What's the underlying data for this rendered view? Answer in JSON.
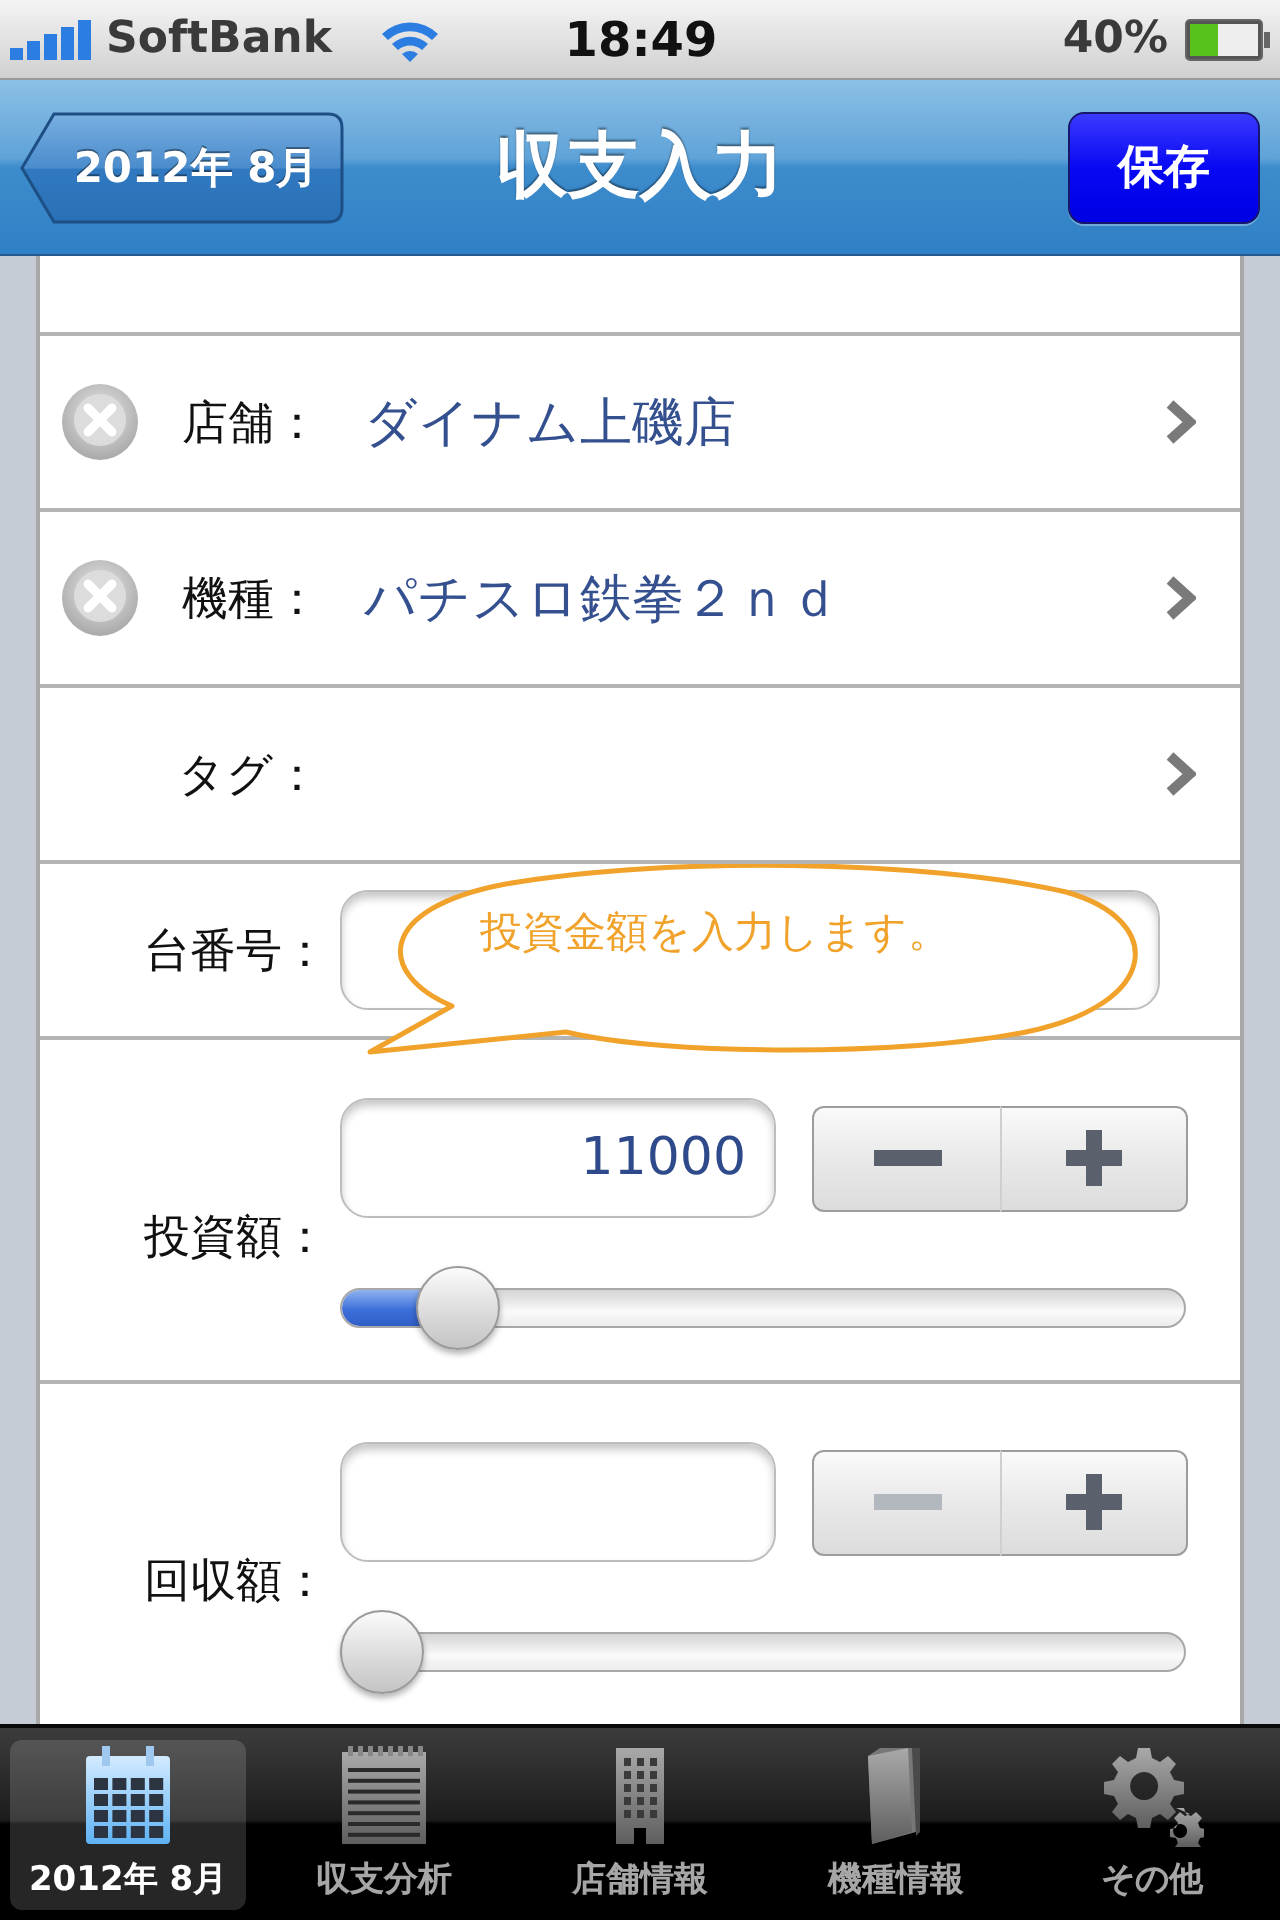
{
  "status_bar": {
    "carrier": "SoftBank",
    "time": "18:49",
    "battery": "40%"
  },
  "nav_bar": {
    "back_button": "2012年 8月",
    "title": "収支入力",
    "save_button": "保存"
  },
  "form": {
    "rows": [
      {
        "kind": "picker",
        "label": "店舗：",
        "value": "ダイナム上磯店",
        "clear_button": true
      },
      {
        "kind": "picker",
        "label": "機種：",
        "value": "パチスロ鉄拳２ｎｄ",
        "clear_button": true
      },
      {
        "kind": "picker",
        "label": "タグ：",
        "clear_button": false
      },
      {
        "kind": "text",
        "label": "台番号："
      },
      {
        "kind": "amount",
        "label": "投資額：",
        "value": "11000",
        "minus_enabled": true,
        "level": 0.1
      },
      {
        "kind": "amount",
        "label": "回収額：",
        "minus_enabled": false,
        "level": 0
      }
    ]
  },
  "callout": {
    "text": "投資金額を入力します。"
  },
  "tab_bar": {
    "tabs": [
      {
        "label": "2012年 8月",
        "selected": true
      },
      {
        "label": "収支分析",
        "selected": false
      },
      {
        "label": "店舗情報",
        "selected": false
      },
      {
        "label": "機種情報",
        "selected": false
      },
      {
        "label": "その他",
        "selected": false
      }
    ]
  }
}
